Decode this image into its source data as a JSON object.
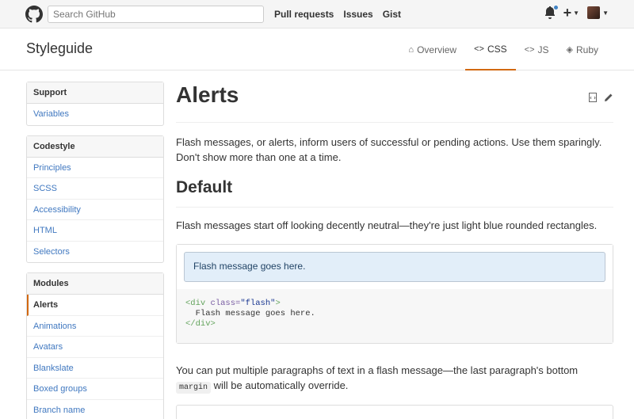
{
  "topbar": {
    "search_placeholder": "Search GitHub",
    "nav": [
      "Pull requests",
      "Issues",
      "Gist"
    ]
  },
  "styleguide": {
    "title": "Styleguide",
    "tabs": [
      {
        "icon": "⌂",
        "label": "Overview"
      },
      {
        "icon": "<>",
        "label": "CSS"
      },
      {
        "icon": "<>",
        "label": "JS"
      },
      {
        "icon": "◈",
        "label": "Ruby"
      }
    ]
  },
  "sidebar": {
    "support": {
      "heading": "Support",
      "items": [
        "Variables"
      ]
    },
    "codestyle": {
      "heading": "Codestyle",
      "items": [
        "Principles",
        "SCSS",
        "Accessibility",
        "HTML",
        "Selectors"
      ]
    },
    "modules": {
      "heading": "Modules",
      "items": [
        "Alerts",
        "Animations",
        "Avatars",
        "Blankslate",
        "Boxed groups",
        "Branch name"
      ]
    }
  },
  "content": {
    "title": "Alerts",
    "intro": "Flash messages, or alerts, inform users of successful or pending actions. Use them sparingly. Don't show more than one at a time.",
    "section_title": "Default",
    "section_desc": "Flash messages start off looking decently neutral—they're just light blue rounded rectangles.",
    "flash_text": "Flash message goes here.",
    "code": {
      "open_tag": "<div",
      "attr": " class=",
      "value": "\"flash\"",
      "close_bracket": ">",
      "body": "  Flash message goes here.",
      "end_tag": "</div>"
    },
    "para_before_code": "You can put multiple paragraphs of text in a flash message—the last paragraph's bottom ",
    "inline_code": "margin",
    "para_after_code": " will be automatically override."
  }
}
